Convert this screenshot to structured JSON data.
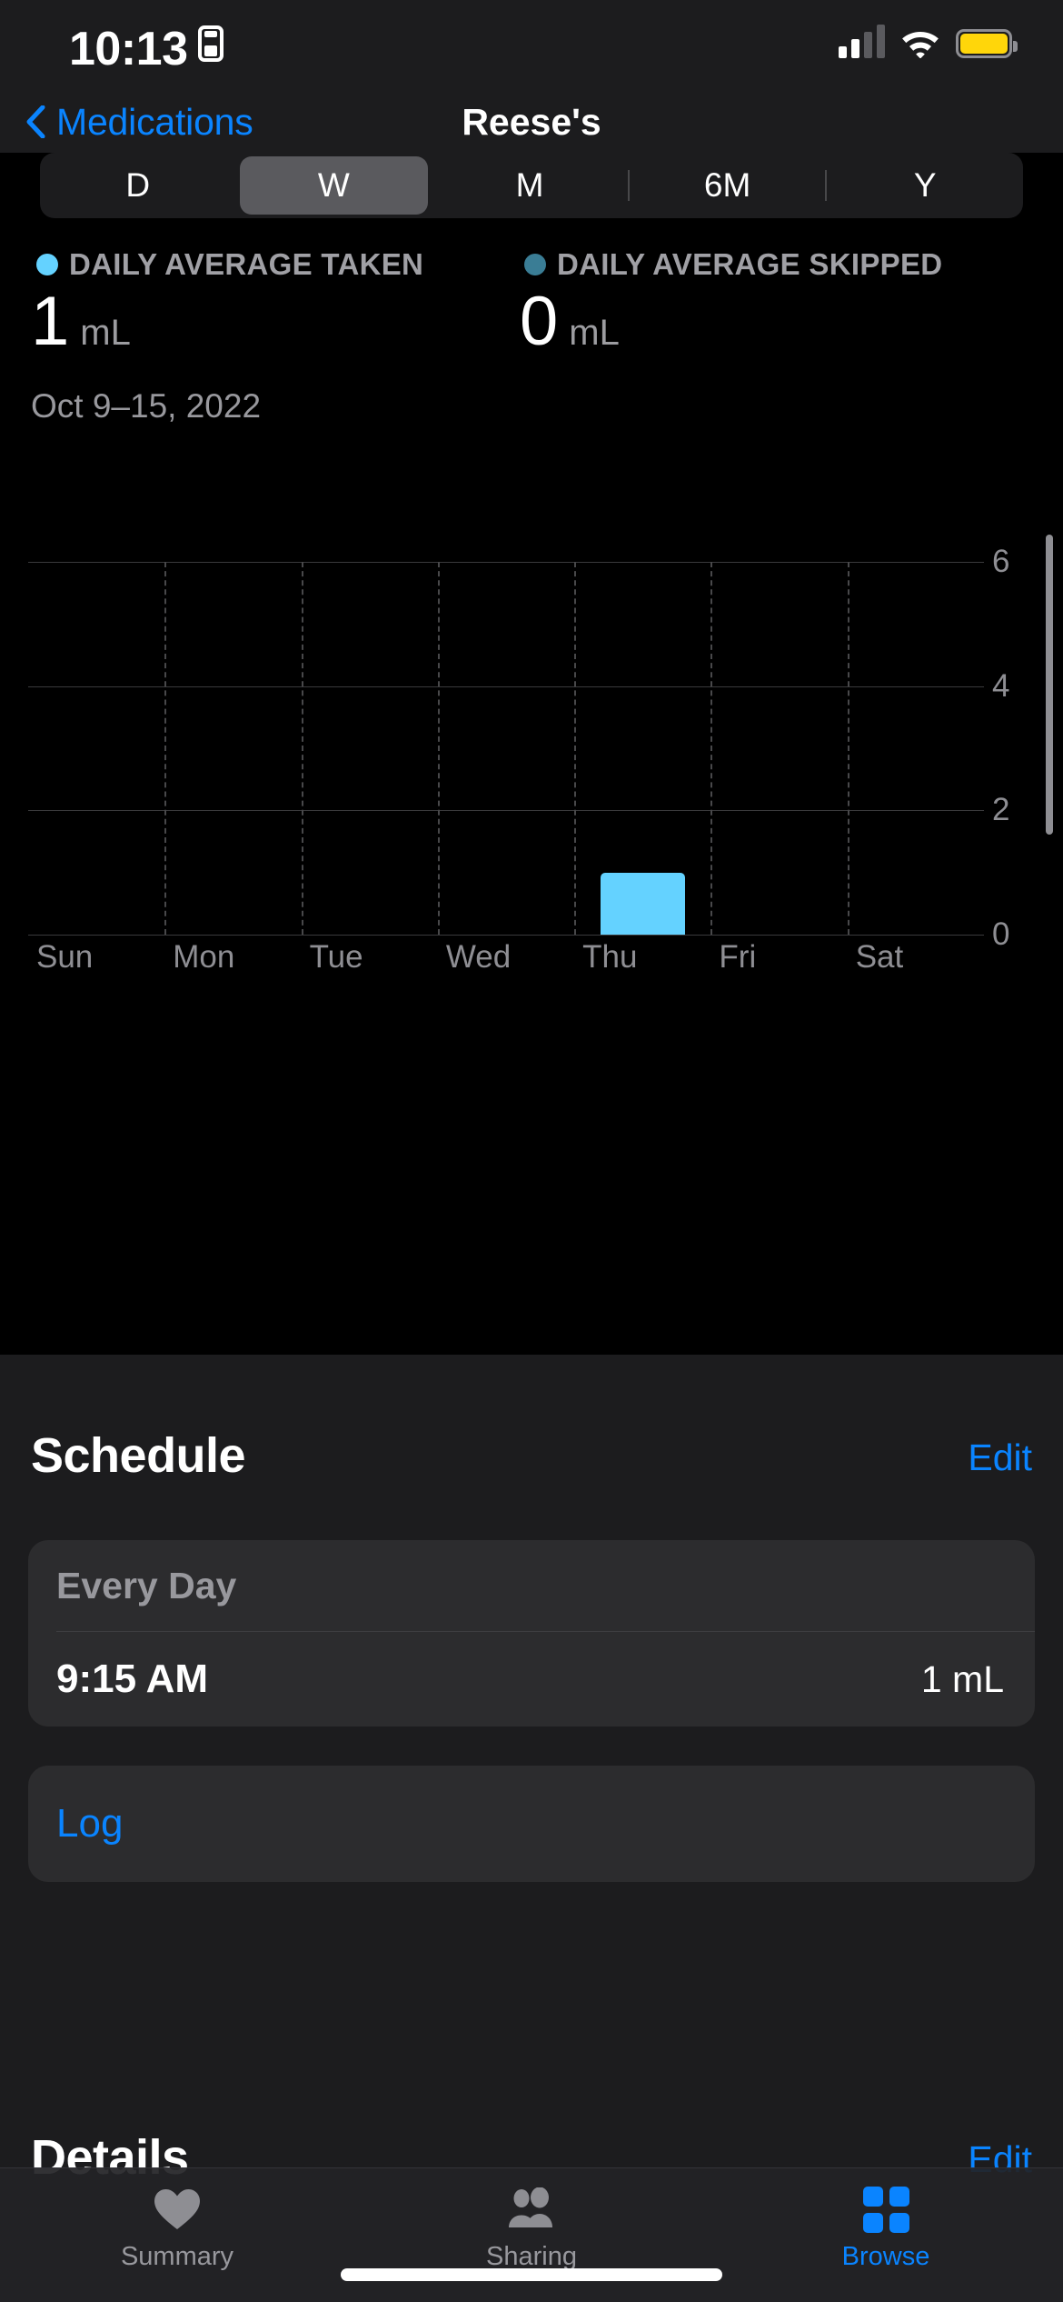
{
  "status_bar": {
    "time": "10:13",
    "recording_icon": "screen-record-icon",
    "cellular_icon": "cellular-bars-icon",
    "wifi_icon": "wifi-icon",
    "battery_icon": "battery-low-power-icon",
    "battery_color": "#ffd60a"
  },
  "nav": {
    "back_label": "Medications",
    "back_icon": "chevron-left-icon",
    "title": "Reese's"
  },
  "segmented": {
    "options": [
      "D",
      "W",
      "M",
      "6M",
      "Y"
    ],
    "selected": "W"
  },
  "summary": {
    "taken": {
      "legend": "DAILY AVERAGE TAKEN",
      "value": "1",
      "unit": "mL",
      "color": "#64d2ff"
    },
    "skipped": {
      "legend": "DAILY AVERAGE SKIPPED",
      "value": "0",
      "unit": "mL",
      "color": "#3a7d95"
    },
    "date_range": "Oct 9–15, 2022"
  },
  "chart_data": {
    "type": "bar",
    "title": "",
    "subtitle": "Oct 9–15, 2022",
    "xlabel": "",
    "ylabel": "",
    "categories": [
      "Sun",
      "Mon",
      "Tue",
      "Wed",
      "Thu",
      "Fri",
      "Sat"
    ],
    "series": [
      {
        "name": "Daily Average Taken",
        "color": "#64d2ff",
        "values": [
          0,
          0,
          0,
          0,
          1,
          0,
          0
        ]
      },
      {
        "name": "Daily Average Skipped",
        "color": "#3a7d95",
        "values": [
          0,
          0,
          0,
          0,
          0,
          0,
          0
        ]
      }
    ],
    "ylim": [
      0,
      6
    ],
    "yticks": [
      0,
      2,
      4,
      6
    ],
    "ytick_labels": [
      "0",
      "2",
      "4",
      "6"
    ],
    "grid": true,
    "legend_position": "top"
  },
  "schedule": {
    "title": "Schedule",
    "edit_label": "Edit",
    "card_header": "Every Day",
    "rows": [
      {
        "time": "9:15 AM",
        "dose": "1 mL"
      }
    ],
    "log_label": "Log"
  },
  "details": {
    "title": "Details",
    "edit_label": "Edit"
  },
  "tabbar": {
    "tabs": [
      {
        "label": "Summary",
        "icon": "heart-icon",
        "active": false
      },
      {
        "label": "Sharing",
        "icon": "people-icon",
        "active": false
      },
      {
        "label": "Browse",
        "icon": "grid-squares-icon",
        "active": true
      }
    ],
    "accent_color": "#0a84ff"
  }
}
